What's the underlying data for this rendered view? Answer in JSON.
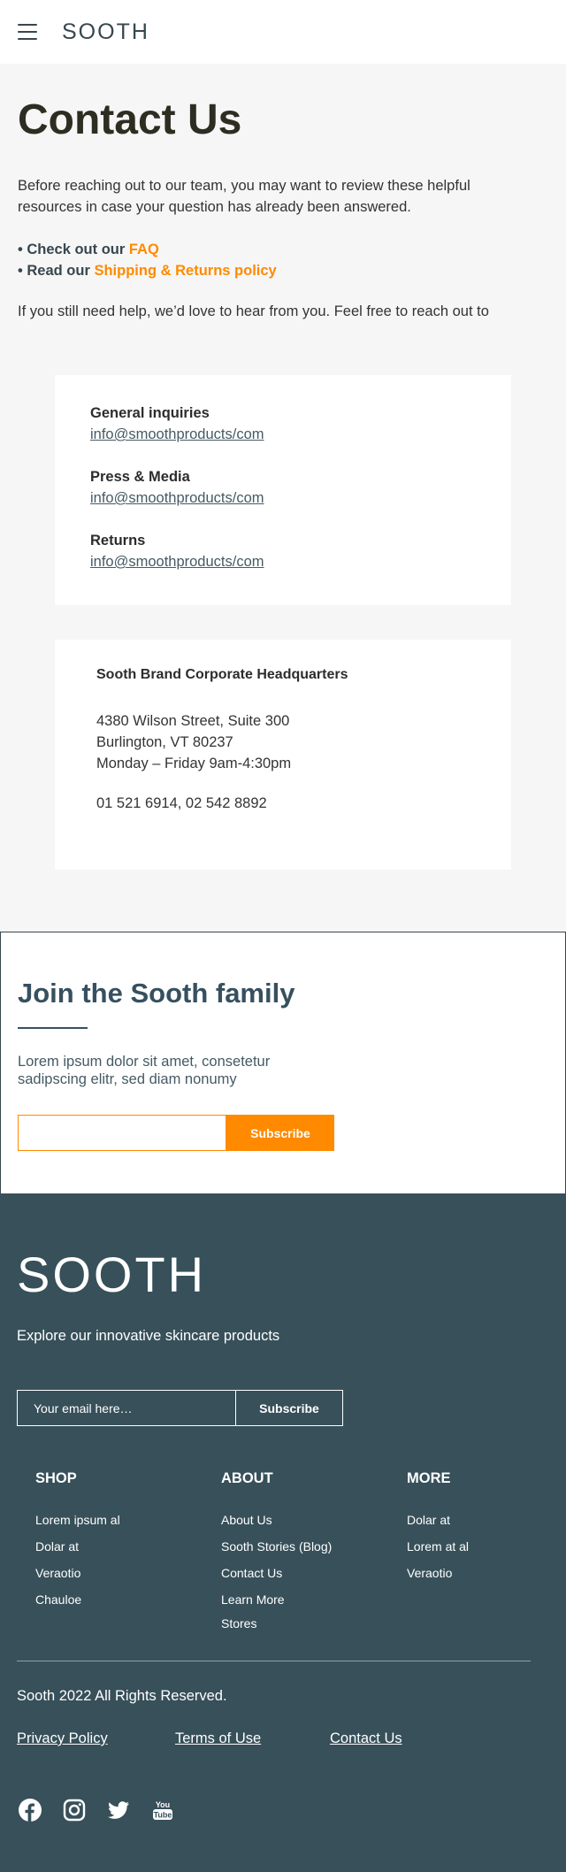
{
  "header": {
    "brand": "SOOTH"
  },
  "intro": {
    "title": "Contact Us",
    "paragraph": "Before reaching out to our team, you may want to review these helpful resources in case your question has already been answered.",
    "bullet1_prefix": "• Check out our ",
    "bullet1_link": "FAQ",
    "bullet2_prefix": "• Read our ",
    "bullet2_link": "Shipping & Returns policy",
    "still_help": "If you still need help, we’d love to hear from you. Feel free to reach out to"
  },
  "inquiries": [
    {
      "label": "General inquiries",
      "email": "info@smoothproducts/com"
    },
    {
      "label": "Press & Media",
      "email": "info@smoothproducts/com"
    },
    {
      "label": "Returns",
      "email": "info@smoothproducts/com"
    }
  ],
  "headquarters": {
    "title": "Sooth Brand Corporate Headquarters",
    "street": "4380 Wilson Street, Suite 300",
    "city": "Burlington, VT 80237",
    "hours": "Monday – Friday 9am-4:30pm",
    "phones": "01 521 6914, 02 542 8892"
  },
  "newsletter": {
    "title": "Join the Sooth family",
    "text": "Lorem ipsum dolor sit amet, consetetur sadipscing elitr, sed diam nonumy",
    "input_value": "",
    "button": "Subscribe"
  },
  "footer": {
    "brand": "SOOTH",
    "tagline": "Explore our innovative skincare products",
    "email_placeholder": "Your email here…",
    "subscribe": "Subscribe",
    "columns": [
      {
        "heading": "SHOP",
        "items": [
          "Lorem ipsum al",
          "Dolar at",
          "Veraotio",
          "Chauloe"
        ]
      },
      {
        "heading": "ABOUT",
        "items": [
          "About Us",
          "Sooth Stories (Blog)",
          "Contact Us",
          "Learn More",
          "Stores"
        ]
      },
      {
        "heading": "MORE",
        "items": [
          "Dolar at",
          "Lorem at al",
          "Veraotio"
        ]
      }
    ],
    "copyright": "Sooth 2022 All Rights Reserved.",
    "legal": [
      "Privacy Policy",
      "Terms of Use",
      "Contact Us"
    ],
    "social_icons": [
      "facebook-icon",
      "instagram-icon",
      "twitter-icon",
      "youtube-icon"
    ]
  },
  "colors": {
    "accent": "#ff8a00",
    "dark": "#37505a",
    "title": "#2d2d22",
    "link": "#455a64"
  }
}
